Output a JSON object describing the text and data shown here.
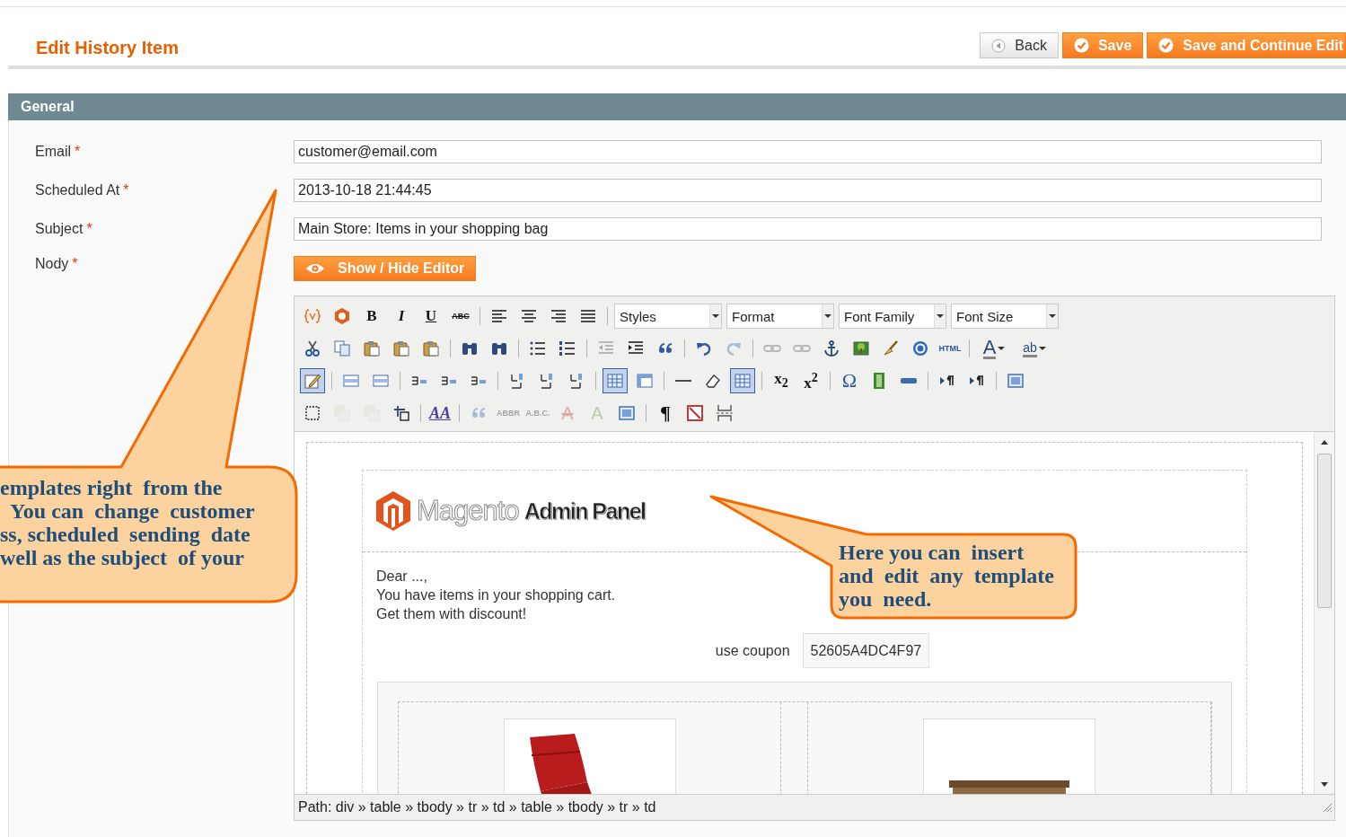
{
  "page_title": "Edit History Item",
  "actions": [
    {
      "label": "Back",
      "kind": "back"
    },
    {
      "label": "Save",
      "kind": "primary"
    },
    {
      "label": "Save and Continue Edit",
      "kind": "primary"
    }
  ],
  "section": {
    "title": "General"
  },
  "fields": [
    {
      "label": "Email",
      "mark": "*",
      "value": "customer@email.com"
    },
    {
      "label": "Scheduled At",
      "mark": "*",
      "value": "2013-10-18 21:44:45"
    },
    {
      "label": "Subject",
      "mark": "*",
      "value": "Main Store: Items in your shopping bag"
    }
  ],
  "body_field": {
    "label": "Nody",
    "mark": "*",
    "toggle": "Show / Hide Editor"
  },
  "toolbar": {
    "lines": [
      {
        "items": [
          {
            "kind": "button",
            "selected": false,
            "disabled": false
          },
          {
            "kind": "button",
            "selected": false,
            "disabled": false
          },
          {
            "kind": "button",
            "glyph": "B",
            "selected": false,
            "disabled": false
          },
          {
            "kind": "button",
            "glyph": "I",
            "selected": false,
            "disabled": false
          },
          {
            "kind": "button",
            "glyph": "U",
            "selected": false,
            "disabled": false
          },
          {
            "kind": "button",
            "glyph": "ABC",
            "selected": false,
            "disabled": false
          },
          {
            "kind": "separator"
          },
          {
            "kind": "button",
            "selected": false,
            "disabled": false
          },
          {
            "kind": "button",
            "selected": false,
            "disabled": false
          },
          {
            "kind": "button",
            "selected": false,
            "disabled": false
          },
          {
            "kind": "button",
            "selected": false,
            "disabled": false
          },
          {
            "kind": "separator"
          },
          {
            "kind": "select",
            "label": "Styles"
          },
          {
            "kind": "select",
            "label": "Format"
          },
          {
            "kind": "select",
            "label": "Font Family"
          },
          {
            "kind": "select",
            "label": "Font Size"
          }
        ]
      },
      {
        "items": [
          {
            "kind": "button",
            "selected": false,
            "disabled": false
          },
          {
            "kind": "button",
            "selected": false,
            "disabled": false
          },
          {
            "kind": "button",
            "selected": false,
            "disabled": false
          },
          {
            "kind": "button",
            "selected": false,
            "disabled": false
          },
          {
            "kind": "button",
            "selected": false,
            "disabled": false
          },
          {
            "kind": "separator"
          },
          {
            "kind": "button",
            "selected": false,
            "disabled": false
          },
          {
            "kind": "button",
            "selected": false,
            "disabled": false
          },
          {
            "kind": "separator"
          },
          {
            "kind": "button",
            "selected": false,
            "disabled": false
          },
          {
            "kind": "button",
            "selected": false,
            "disabled": false
          },
          {
            "kind": "separator"
          },
          {
            "kind": "button",
            "selected": false,
            "disabled": true
          },
          {
            "kind": "button",
            "selected": false,
            "disabled": false
          },
          {
            "kind": "button",
            "selected": false,
            "disabled": false
          },
          {
            "kind": "separator"
          },
          {
            "kind": "button",
            "selected": false,
            "disabled": false
          },
          {
            "kind": "button",
            "selected": false,
            "disabled": true
          },
          {
            "kind": "separator"
          },
          {
            "kind": "button",
            "selected": false,
            "disabled": true
          },
          {
            "kind": "button",
            "selected": false,
            "disabled": true
          },
          {
            "kind": "button",
            "selected": false,
            "disabled": false
          },
          {
            "kind": "button",
            "selected": false,
            "disabled": false
          },
          {
            "kind": "button",
            "selected": false,
            "disabled": false
          },
          {
            "kind": "button",
            "selected": false,
            "disabled": false
          },
          {
            "kind": "button",
            "glyph": "HTML",
            "selected": false,
            "disabled": false
          },
          {
            "kind": "separator"
          },
          {
            "kind": "button",
            "glyph": "A",
            "split": true,
            "selected": false,
            "disabled": false
          },
          {
            "kind": "button",
            "glyph": "ab",
            "split": true,
            "selected": false,
            "disabled": false
          }
        ]
      },
      {
        "items": [
          {
            "kind": "button",
            "selected": true,
            "disabled": false
          },
          {
            "kind": "separator"
          },
          {
            "kind": "button",
            "selected": false,
            "disabled": false
          },
          {
            "kind": "button",
            "selected": false,
            "disabled": false
          },
          {
            "kind": "separator"
          },
          {
            "kind": "button",
            "selected": false,
            "disabled": false
          },
          {
            "kind": "button",
            "selected": false,
            "disabled": false
          },
          {
            "kind": "button",
            "selected": false,
            "disabled": false
          },
          {
            "kind": "separator"
          },
          {
            "kind": "button",
            "selected": false,
            "disabled": false
          },
          {
            "kind": "button",
            "selected": false,
            "disabled": false
          },
          {
            "kind": "button",
            "selected": false,
            "disabled": false
          },
          {
            "kind": "separator"
          },
          {
            "kind": "button",
            "selected": true,
            "disabled": false
          },
          {
            "kind": "button",
            "selected": false,
            "disabled": false
          },
          {
            "kind": "separator"
          },
          {
            "kind": "button",
            "selected": false,
            "disabled": false
          },
          {
            "kind": "button",
            "selected": false,
            "disabled": false
          },
          {
            "kind": "button",
            "selected": true,
            "disabled": false
          },
          {
            "kind": "separator"
          },
          {
            "kind": "button",
            "glyph": "x$_{2}$",
            "selected": false,
            "disabled": false
          },
          {
            "kind": "button",
            "glyph": "x$^{2}$",
            "selected": false,
            "disabled": false
          },
          {
            "kind": "separator"
          },
          {
            "kind": "button",
            "glyph": "Ω",
            "selected": false,
            "disabled": false
          },
          {
            "kind": "button",
            "selected": false,
            "disabled": false
          },
          {
            "kind": "button",
            "selected": false,
            "disabled": false
          },
          {
            "kind": "separator"
          },
          {
            "kind": "button",
            "selected": false,
            "disabled": false
          },
          {
            "kind": "button",
            "selected": false,
            "disabled": false
          },
          {
            "kind": "separator"
          },
          {
            "kind": "button",
            "selected": false,
            "disabled": false
          }
        ]
      },
      {
        "items": [
          {
            "kind": "button",
            "selected": false,
            "disabled": false
          },
          {
            "kind": "button",
            "selected": false,
            "disabled": true
          },
          {
            "kind": "button",
            "selected": false,
            "disabled": true
          },
          {
            "kind": "button",
            "selected": false,
            "disabled": false
          },
          {
            "kind": "separator"
          },
          {
            "kind": "button",
            "glyph": "AA",
            "selected": false,
            "disabled": false
          },
          {
            "kind": "separator"
          },
          {
            "kind": "button",
            "selected": false,
            "disabled": true
          },
          {
            "kind": "button",
            "glyph": "ABBR",
            "selected": false,
            "disabled": true
          },
          {
            "kind": "button",
            "glyph": "A.B.C.",
            "selected": false,
            "disabled": true
          },
          {
            "kind": "button",
            "glyph": "A",
            "selected": false,
            "disabled": true
          },
          {
            "kind": "button",
            "glyph": "A",
            "selected": false,
            "disabled": true
          },
          {
            "kind": "button",
            "selected": false,
            "disabled": false
          },
          {
            "kind": "separator"
          },
          {
            "kind": "button",
            "glyph": "¶",
            "selected": false,
            "disabled": false
          },
          {
            "kind": "button",
            "selected": false,
            "disabled": false
          },
          {
            "kind": "button",
            "selected": false,
            "disabled": false
          }
        ]
      }
    ]
  },
  "email_preview": {
    "logo_word": "Magento",
    "logo_suffix": "Admin Panel",
    "greeting": "Dear  ...,",
    "lines": [
      "You have items in your shopping cart.",
      "Get them with discount!"
    ],
    "coupon_label": "use coupon",
    "coupon_code": "52605A4DC4F97",
    "products": [
      {
        "kind": "picture"
      },
      {
        "kind": "picture"
      }
    ]
  },
  "path_bar": "Path: div » table » tbody » tr » td » table » tbody » tr » td",
  "callouts": [
    {
      "kind": "left",
      "text": "emplates right  from the\n  You can  change  customer\nss, scheduled  sending  date\nwell as the subject  of your"
    },
    {
      "kind": "right",
      "text": "Here you can  insert\nand  edit  any  template\nyou  need."
    }
  ]
}
